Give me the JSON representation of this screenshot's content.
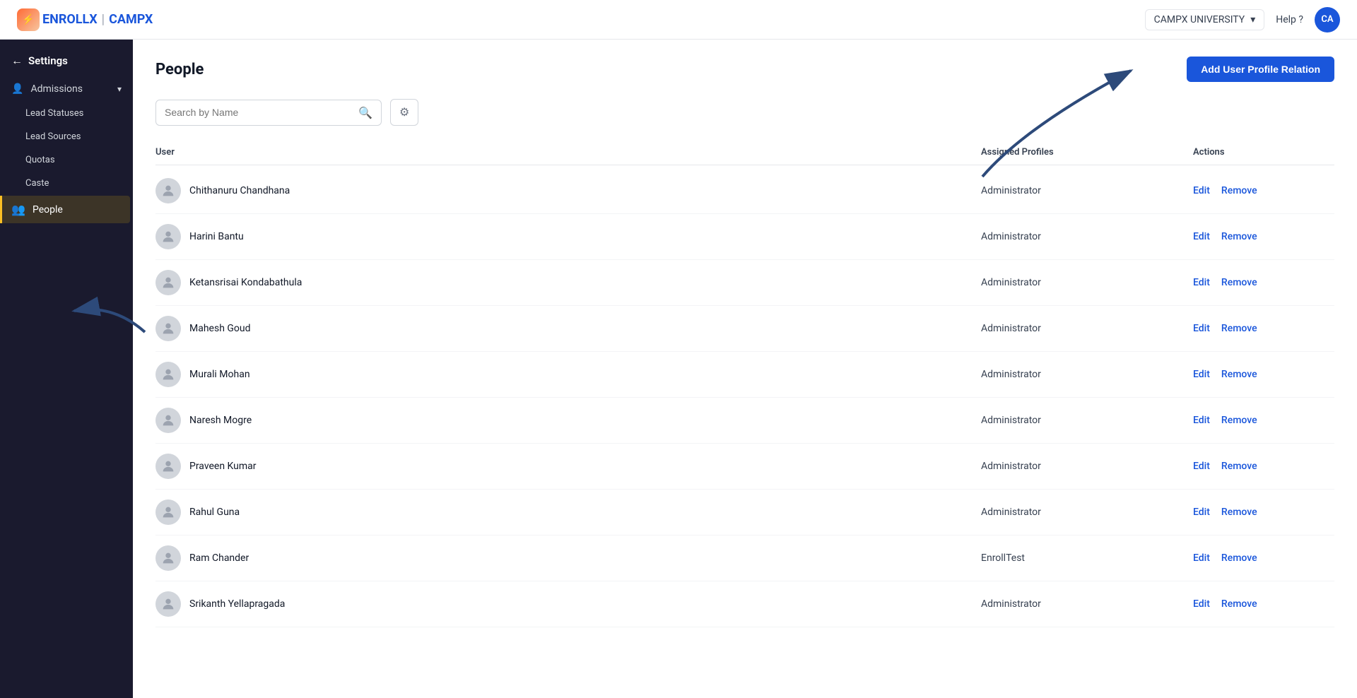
{
  "navbar": {
    "logo_icon": "⚡",
    "logo_enrollx": "ENROLLX",
    "logo_divider": "|",
    "logo_campx": "CAMPX",
    "org_name": "CAMPX UNIVERSITY",
    "help_label": "Help ?",
    "avatar_initials": "CA"
  },
  "sidebar": {
    "back_label": "Settings",
    "admissions_label": "Admissions",
    "sub_items": [
      {
        "label": "Lead Statuses"
      },
      {
        "label": "Lead Sources"
      },
      {
        "label": "Quotas"
      },
      {
        "label": "Caste"
      }
    ],
    "people_label": "People"
  },
  "main": {
    "page_title": "People",
    "add_btn_label": "Add User Profile Relation",
    "search_placeholder": "Search by Name",
    "table_headers": {
      "user": "User",
      "assigned_profiles": "Assigned Profiles",
      "actions": "Actions"
    },
    "rows": [
      {
        "name": "Chithanuru Chandhana",
        "profile": "Administrator",
        "edit": "Edit",
        "remove": "Remove"
      },
      {
        "name": "Harini Bantu",
        "profile": "Administrator",
        "edit": "Edit",
        "remove": "Remove"
      },
      {
        "name": "Ketansrisai Kondabathula",
        "profile": "Administrator",
        "edit": "Edit",
        "remove": "Remove"
      },
      {
        "name": "Mahesh Goud",
        "profile": "Administrator",
        "edit": "Edit",
        "remove": "Remove"
      },
      {
        "name": "Murali Mohan",
        "profile": "Administrator",
        "edit": "Edit",
        "remove": "Remove"
      },
      {
        "name": "Naresh Mogre",
        "profile": "Administrator",
        "edit": "Edit",
        "remove": "Remove"
      },
      {
        "name": "Praveen Kumar",
        "profile": "Administrator",
        "edit": "Edit",
        "remove": "Remove"
      },
      {
        "name": "Rahul Guna",
        "profile": "Administrator",
        "edit": "Edit",
        "remove": "Remove"
      },
      {
        "name": "Ram Chander",
        "profile": "EnrollTest",
        "edit": "Edit",
        "remove": "Remove"
      },
      {
        "name": "Srikanth Yellapragada",
        "profile": "Administrator",
        "edit": "Edit",
        "remove": "Remove"
      }
    ],
    "action_edit": "Edit",
    "action_remove": "Remove"
  }
}
